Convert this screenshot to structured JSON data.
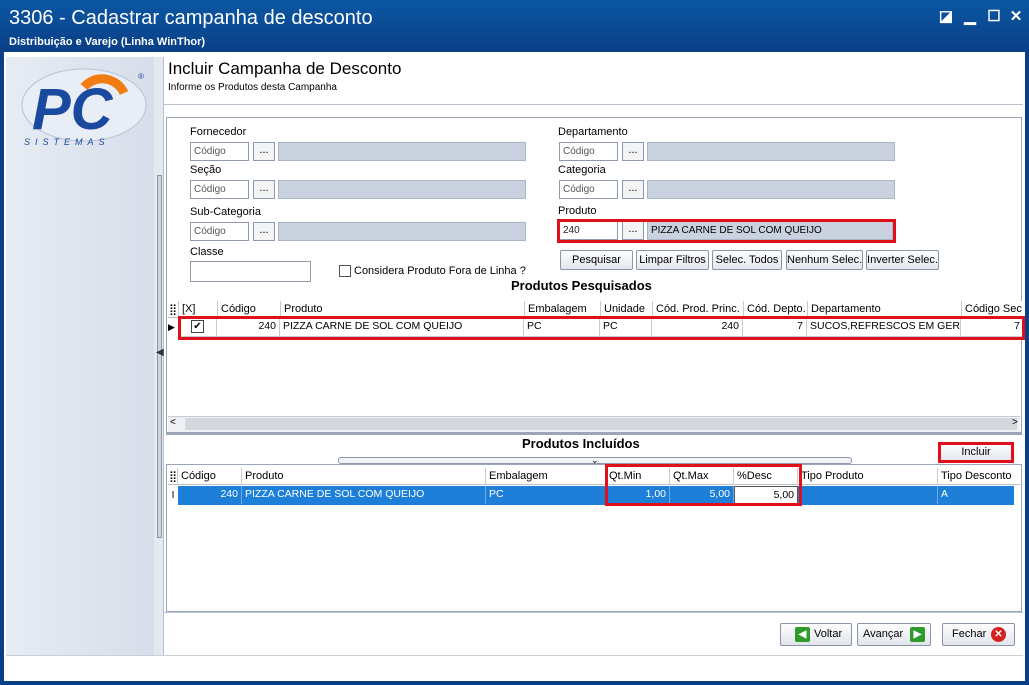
{
  "window": {
    "title": "3306 - Cadastrar campanha de desconto",
    "subtitle": "Distribuição e Varejo (Linha WinThor)"
  },
  "logo": {
    "mark": "PC",
    "word": "SISTEMAS"
  },
  "header": {
    "title": "Incluir Campanha de Desconto",
    "subtitle": "Informe os Produtos desta Campanha"
  },
  "filters": {
    "fornecedor": {
      "label": "Fornecedor",
      "placeholder": "Código"
    },
    "secao": {
      "label": "Seção",
      "placeholder": "Código"
    },
    "subcategoria": {
      "label": "Sub-Categoria",
      "placeholder": "Código"
    },
    "classe": {
      "label": "Classe",
      "value": ""
    },
    "departamento": {
      "label": "Departamento",
      "placeholder": "Código"
    },
    "categoria": {
      "label": "Categoria",
      "placeholder": "Código"
    },
    "produto": {
      "label": "Produto",
      "code": "240",
      "description": "PIZZA CARNE DE SOL COM QUEIJO"
    },
    "fora_linha": {
      "label": "Considera Produto Fora de Linha ?",
      "checked": false
    },
    "dots_label": "..."
  },
  "actions": {
    "pesquisar": "Pesquisar",
    "limpar": "Limpar Filtros",
    "selec_todos": "Selec. Todos",
    "nenhum": "Nenhum Selec.",
    "inverter": "Inverter Selec."
  },
  "results": {
    "title": "Produtos Pesquisados",
    "columns": [
      "[X]",
      "Código",
      "Produto",
      "Embalagem",
      "Unidade",
      "Cód. Prod. Princ.",
      "Cód. Depto.",
      "Departamento",
      "Código Sec."
    ],
    "rows": [
      {
        "checked": true,
        "codigo": "240",
        "produto": "PIZZA CARNE DE SOL COM QUEIJO",
        "embalagem": "PC",
        "unidade": "PC",
        "cod_prod_princ": "240",
        "cod_depto": "7",
        "departamento": "SUCOS,REFRESCOS EM GERAL",
        "codigo_sec": "7"
      }
    ]
  },
  "included": {
    "title": "Produtos Incluídos",
    "incluir_label": "Incluir",
    "columns": [
      "Código",
      "Produto",
      "Embalagem",
      "Qt.Min",
      "Qt.Max",
      "%Desc",
      "Tipo Produto",
      "Tipo Desconto"
    ],
    "rows": [
      {
        "codigo": "240",
        "produto": "PIZZA CARNE DE SOL COM QUEIJO",
        "embalagem": "PC",
        "qt_min": "1,00",
        "qt_max": "5,00",
        "desc": "5,00",
        "tipo_produto": "",
        "tipo_desconto": "A"
      }
    ]
  },
  "footer": {
    "voltar": "Voltar",
    "avancar": "Avançar",
    "fechar": "Fechar"
  },
  "colors": {
    "titlebar": "#0a3f86",
    "selection": "#1e7fd8",
    "highlight": "#e0101a",
    "logo_blue": "#1a4aa0",
    "logo_orange": "#f07c13"
  }
}
